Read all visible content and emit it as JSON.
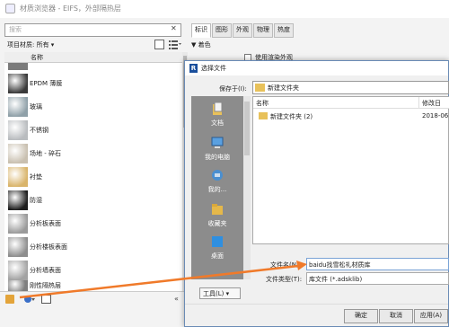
{
  "app": {
    "title": "材质浏览器 - EIFS，外部隔热层"
  },
  "search": {
    "placeholder": "搜索",
    "clear": "✕"
  },
  "filter": {
    "label": "项目材质: 所有 ▾"
  },
  "list": {
    "header": "名称",
    "items": [
      {
        "label": "EPDM 薄膜",
        "color": "#3a3a3a"
      },
      {
        "label": "玻璃",
        "color": "#8fa0a8"
      },
      {
        "label": "不锈钢",
        "color": "#b9bcbf"
      },
      {
        "label": "场地 - 碎石",
        "color": "#c9c0b0"
      },
      {
        "label": "衬垫",
        "color": "#d9b46a"
      },
      {
        "label": "防湿",
        "color": "#1e1e1e"
      },
      {
        "label": "分析板表面",
        "color": "#9a9a9a"
      },
      {
        "label": "分析楼板表面",
        "color": "#8d8d8d"
      },
      {
        "label": "分析墙表面",
        "color": "#a3a3a3"
      },
      {
        "label": "刚性隔热层",
        "color": "#7f7f7f"
      }
    ]
  },
  "bottom": {
    "collapse": "«"
  },
  "tabs": [
    "标识",
    "图形",
    "外观",
    "物理",
    "热度"
  ],
  "appearance": {
    "section": "▼ 着色",
    "render_label": "使用渲染外观"
  },
  "dialog": {
    "title": "选择文件",
    "icon_letter": "R",
    "savein_label": "保存于(I):",
    "savein_value": "新建文件夹",
    "places": [
      {
        "label": "文档",
        "color": "#e8c15a"
      },
      {
        "label": "我的电脑",
        "color": "#5aa0e0"
      },
      {
        "label": "我的...",
        "color": "#4a8fd0"
      },
      {
        "label": "收藏夹",
        "color": "#e5b84a"
      },
      {
        "label": "桌面",
        "color": "#2f8fe0"
      }
    ],
    "columns": {
      "name": "名称",
      "date": "修改日"
    },
    "files": [
      {
        "name": "新建文件夹 (2)",
        "date": "2018-06"
      }
    ],
    "filename_label": "文件名(N):",
    "filename_value": "baidu找雪松礼材质库",
    "filetype_label": "文件类型(T):",
    "filetype_value": "库文件 (*.adsklib)",
    "tools": "工具(L) ▾",
    "buttons": [
      "确定",
      "取消",
      "应用(A)"
    ]
  },
  "colors": {
    "arrow": "#f07a2a",
    "accent": "#1a4f9c"
  }
}
